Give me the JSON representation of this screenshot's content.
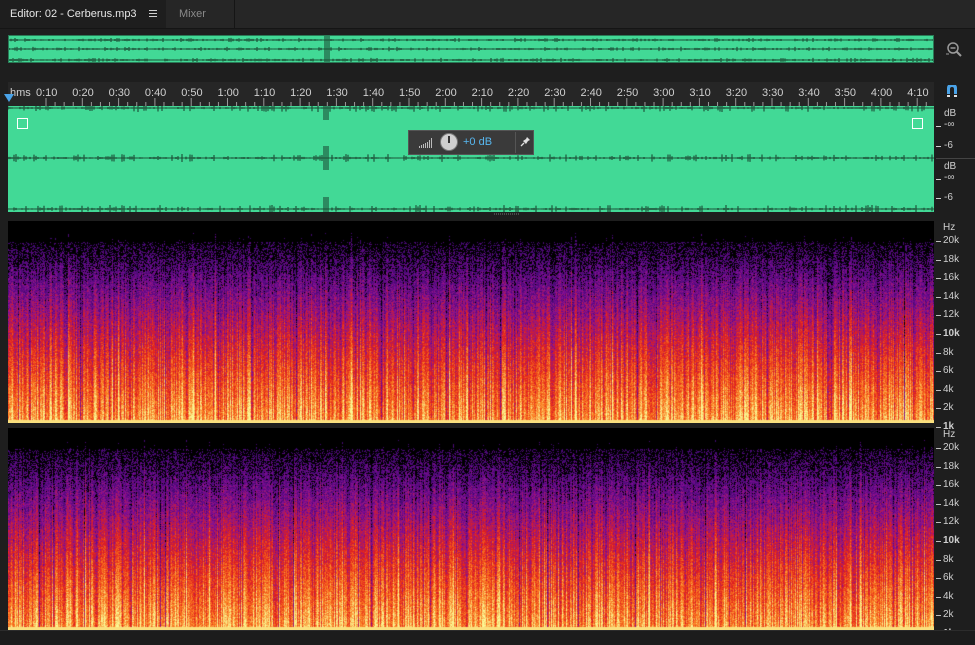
{
  "tabs": [
    {
      "label": "Editor: 02 - Cerberus.mp3",
      "active": true
    },
    {
      "label": "Mixer",
      "active": false
    }
  ],
  "ruler": {
    "unit_label": "hms",
    "ticks": [
      "0:10",
      "0:20",
      "0:30",
      "0:40",
      "0:50",
      "1:00",
      "1:10",
      "1:20",
      "1:30",
      "1:40",
      "1:50",
      "2:00",
      "2:10",
      "2:20",
      "2:30",
      "2:40",
      "2:50",
      "3:00",
      "3:10",
      "3:20",
      "3:30",
      "3:40",
      "3:50",
      "4:00",
      "4:10"
    ]
  },
  "gain_hud": {
    "value": "+0 dB"
  },
  "db_scale": {
    "unit": "dB",
    "labels": [
      "-∞",
      "-6"
    ]
  },
  "hz_scale": {
    "unit": "Hz",
    "labels": [
      "20k",
      "18k",
      "16k",
      "14k",
      "12k",
      "10k",
      "8k",
      "6k",
      "4k",
      "2k",
      "1k"
    ]
  },
  "colors": {
    "waveform_bg": "#42d996",
    "spectrogram_hot": "#ffe680",
    "spectrogram_mid": "#e0201e",
    "spectrogram_cool": "#7a1aa0",
    "playhead": "#4aa3e8"
  },
  "icons": {
    "zoom": "zoom-out-magnifier-icon",
    "snap": "magnet-icon",
    "pin": "pin-icon",
    "menu": "hamburger-menu-icon"
  }
}
